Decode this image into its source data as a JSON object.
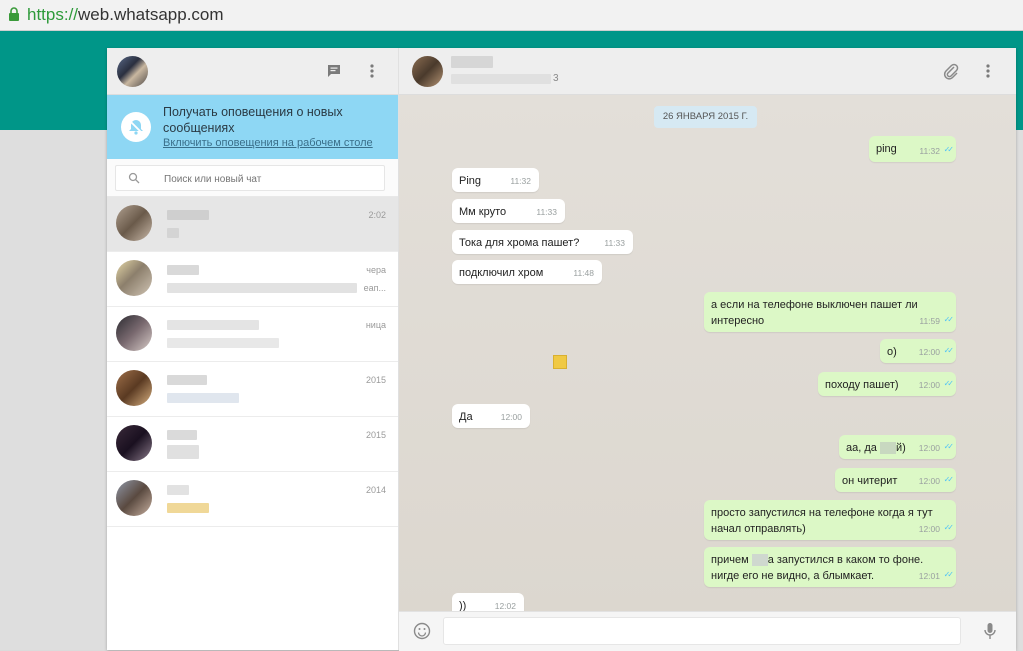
{
  "browser": {
    "url_scheme": "https://",
    "url_host": "web.whatsapp.com"
  },
  "notification": {
    "title": "Получать оповещения о новых сообщениях",
    "link": "Включить оповещения на рабочем столе"
  },
  "search": {
    "placeholder": "Поиск или новый чат"
  },
  "chats": [
    {
      "time": "2:02",
      "snippet": ""
    },
    {
      "time": "чера",
      "snippet": "еап..."
    },
    {
      "time": "ница",
      "snippet": ""
    },
    {
      "time": "2015",
      "snippet": ""
    },
    {
      "time": "2015",
      "snippet": ""
    },
    {
      "time": "2014",
      "snippet": ""
    }
  ],
  "conversation": {
    "header_sub": "3",
    "date": "26 ЯНВАРЯ 2015 Г.",
    "messages": [
      {
        "dir": "out",
        "text": "ping",
        "time": "11:32"
      },
      {
        "dir": "in",
        "text": "Ping",
        "time": "11:32"
      },
      {
        "dir": "in",
        "text": "Мм круто",
        "time": "11:33"
      },
      {
        "dir": "in",
        "text": "Тока для хрома пашет?",
        "time": "11:33"
      },
      {
        "dir": "in",
        "text": "подключил хром",
        "time": "11:48"
      },
      {
        "dir": "out",
        "text": "а если на телефоне выключен пашет ли интересно",
        "time": "11:59"
      },
      {
        "dir": "out",
        "text": "о)",
        "time": "12:00"
      },
      {
        "dir": "out",
        "text": "походу пашет)",
        "time": "12:00"
      },
      {
        "dir": "in",
        "text": "Да",
        "time": "12:00"
      },
      {
        "dir": "out",
        "text_a": "аа, да ",
        "text_b": "й)",
        "time": "12:00"
      },
      {
        "dir": "out",
        "text": "он читерит",
        "time": "12:00"
      },
      {
        "dir": "out",
        "text": "просто запустился на телефоне когда я тут начал отправлять)",
        "time": "12:00"
      },
      {
        "dir": "out",
        "text_a": "причем ",
        "text_b": "а запустился в каком то фоне. нигде его не видно, а блымкает.",
        "time": "12:01"
      },
      {
        "dir": "in",
        "text": "))",
        "time": "12:02"
      }
    ]
  },
  "colors": {
    "teal": "#009688",
    "notify_bg": "#8ed7f4",
    "bubble_out": "#dcf8c6",
    "bubble_in": "#ffffff",
    "tick_read": "#4fc3f7"
  }
}
